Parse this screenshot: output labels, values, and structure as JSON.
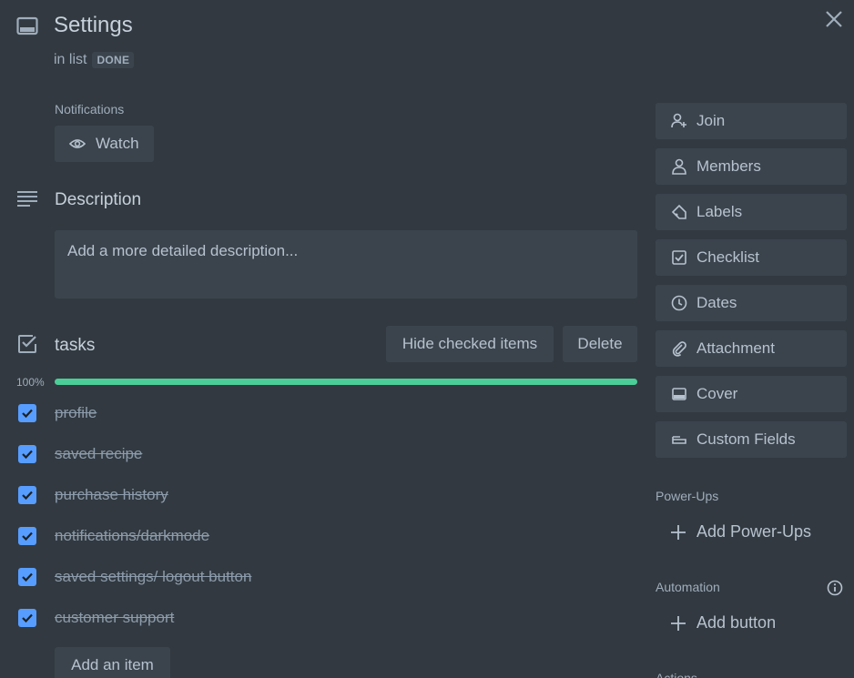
{
  "card": {
    "title": "Settings",
    "in_list_prefix": "in list",
    "list_name": "DONE"
  },
  "notifications": {
    "label": "Notifications",
    "watch_label": "Watch"
  },
  "description": {
    "title": "Description",
    "placeholder": "Add a more detailed description..."
  },
  "checklist": {
    "title": "tasks",
    "hide_checked_label": "Hide checked items",
    "delete_label": "Delete",
    "progress_text": "100%",
    "progress": 1.0,
    "items": [
      {
        "label": "profile",
        "checked": true
      },
      {
        "label": "saved recipe",
        "checked": true
      },
      {
        "label": "purchase history",
        "checked": true
      },
      {
        "label": "notifications/darkmode",
        "checked": true
      },
      {
        "label": "saved settings/ logout button",
        "checked": true
      },
      {
        "label": "customer support",
        "checked": true
      }
    ],
    "add_item_label": "Add an item"
  },
  "sidebar": {
    "buttons": [
      {
        "label": "Join",
        "icon": "person-add-icon"
      },
      {
        "label": "Members",
        "icon": "person-icon"
      },
      {
        "label": "Labels",
        "icon": "tag-icon"
      },
      {
        "label": "Checklist",
        "icon": "checkbox-icon"
      },
      {
        "label": "Dates",
        "icon": "clock-icon"
      },
      {
        "label": "Attachment",
        "icon": "paperclip-icon"
      },
      {
        "label": "Cover",
        "icon": "cover-icon"
      },
      {
        "label": "Custom Fields",
        "icon": "custom-fields-icon"
      }
    ],
    "powerups_label": "Power-Ups",
    "add_powerups_label": "Add Power-Ups",
    "automation_label": "Automation",
    "add_button_label": "Add button",
    "actions_label": "Actions"
  },
  "colors": {
    "background": "#323940",
    "button": "#3b444d",
    "progress": "#4bce97",
    "checkbox": "#579dff"
  }
}
